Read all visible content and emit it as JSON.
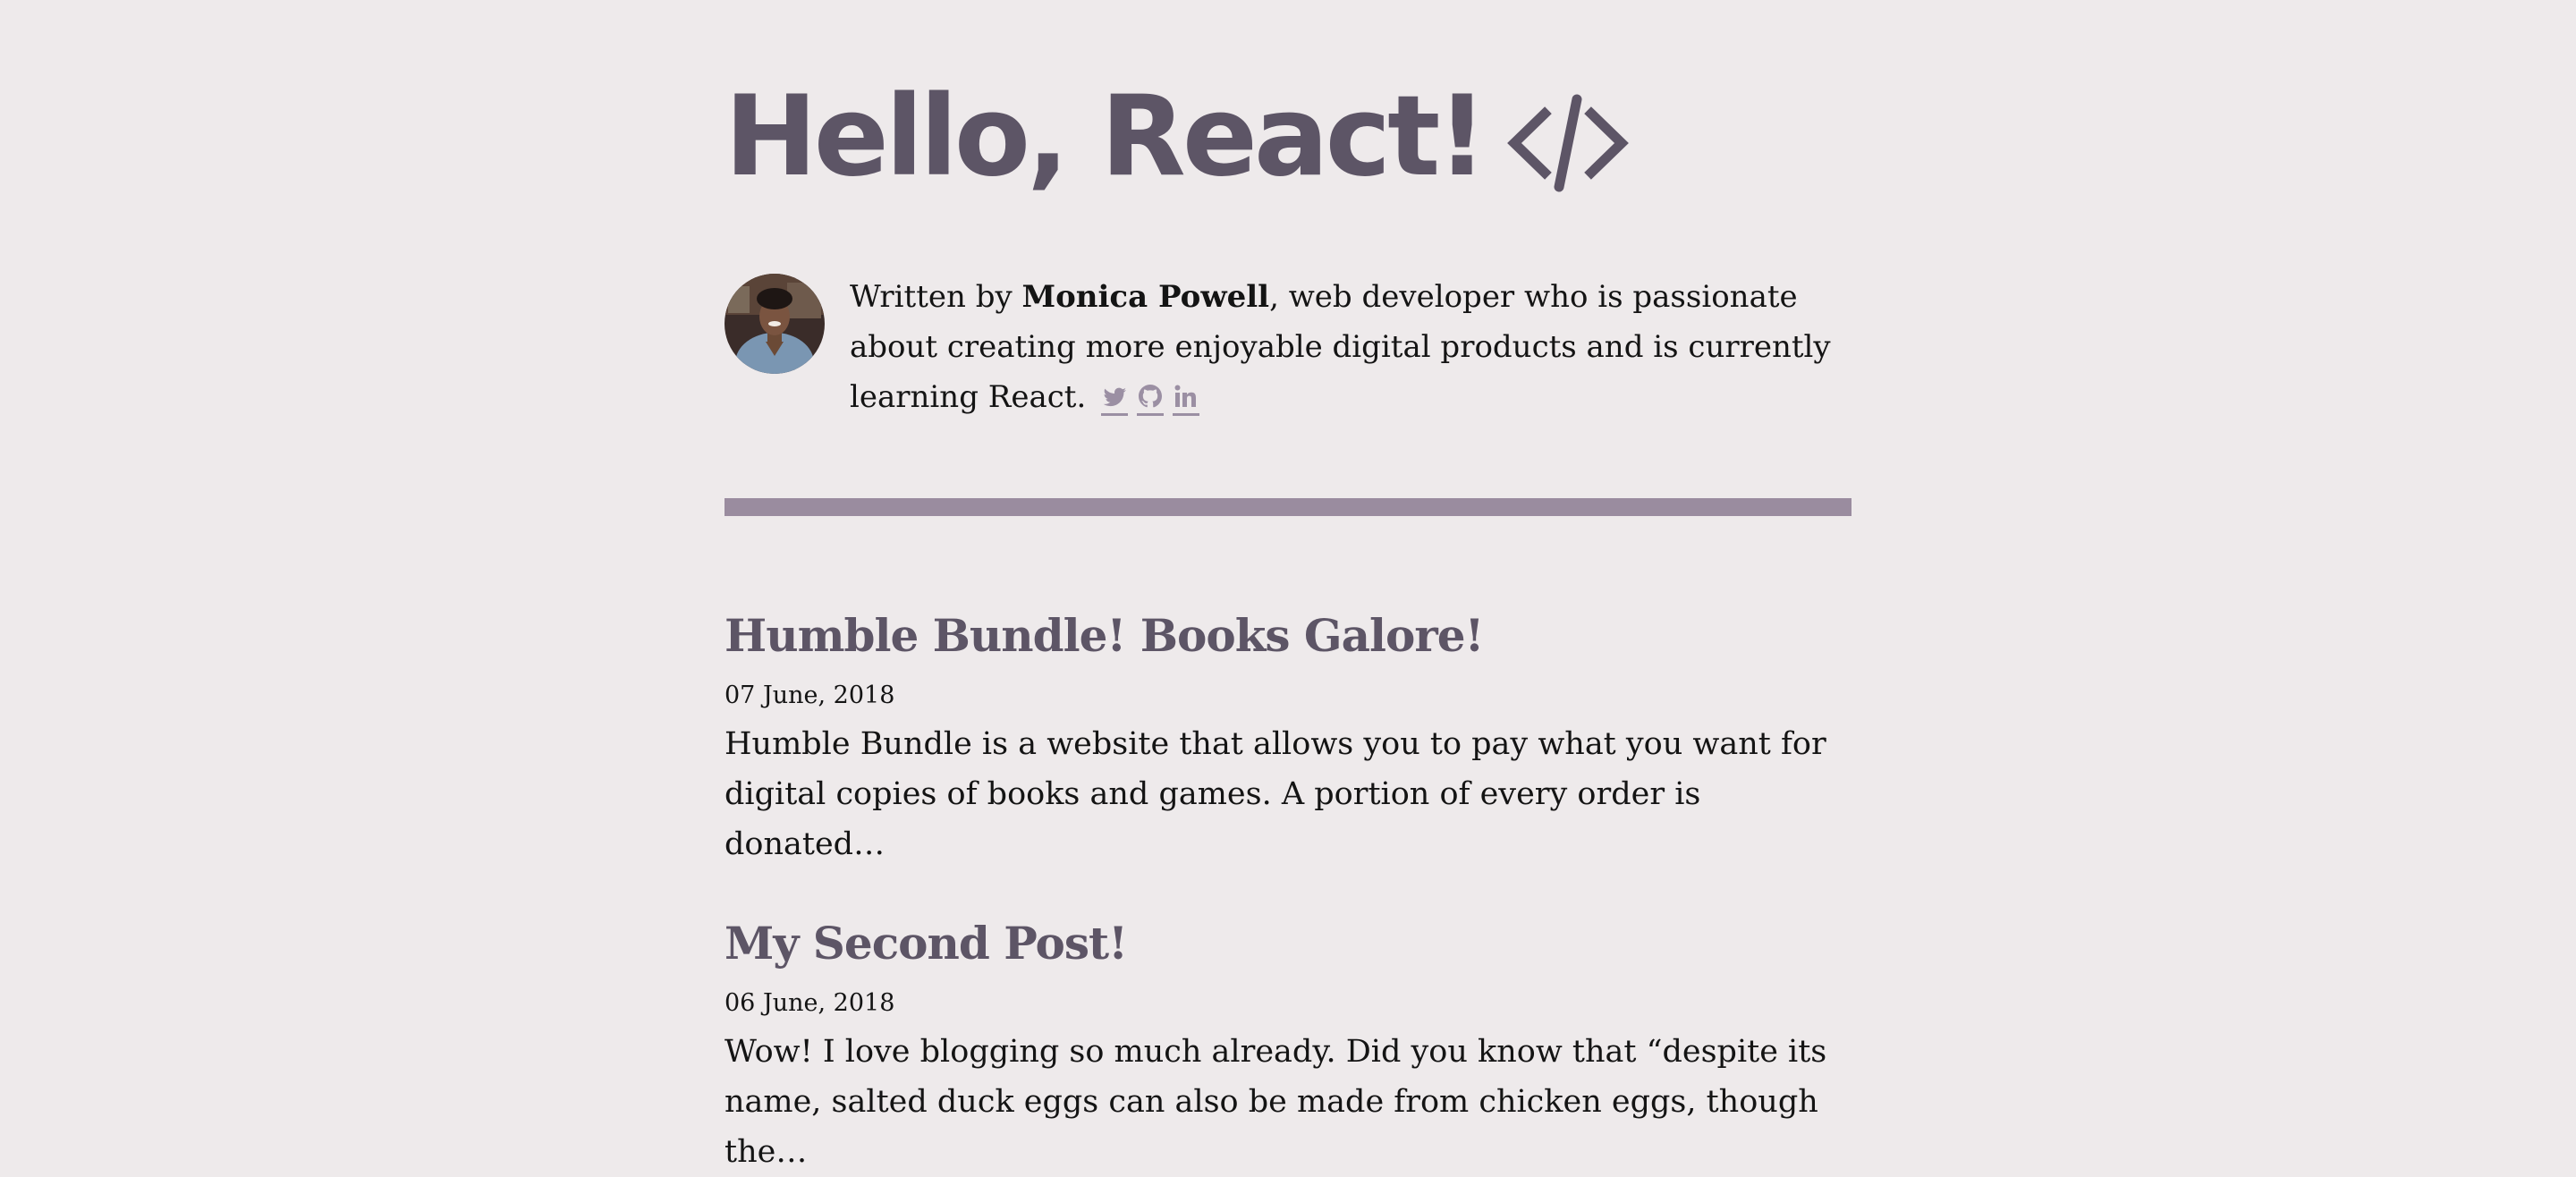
{
  "site": {
    "title": "Hello, React!",
    "title_icon": "code-brackets-icon"
  },
  "bio": {
    "prefix": "Written by ",
    "author": "Monica Powell",
    "suffix": ", web developer who is passionate about creating more enjoyable digital products and is currently learning React.",
    "avatar_icon": "author-photo",
    "social": [
      {
        "name": "twitter-icon"
      },
      {
        "name": "github-icon"
      },
      {
        "name": "linkedin-icon"
      }
    ]
  },
  "colors": {
    "background": "#eeeaeb",
    "heading": "#5d5566",
    "accent_rule": "#9a8c9f",
    "link_underline": "#9b8fa3",
    "body_text": "#141414"
  },
  "posts": [
    {
      "title": "Humble Bundle! Books Galore!",
      "date": "07 June, 2018",
      "excerpt": "Humble Bundle is a website that allows you to pay what you want for digital copies of books and games. A portion of every order is donated…"
    },
    {
      "title": "My Second Post!",
      "date": "06 June, 2018",
      "excerpt": "Wow! I love blogging so much already. Did you know that “despite its name, salted duck eggs can also be made from chicken eggs, though the…"
    }
  ]
}
